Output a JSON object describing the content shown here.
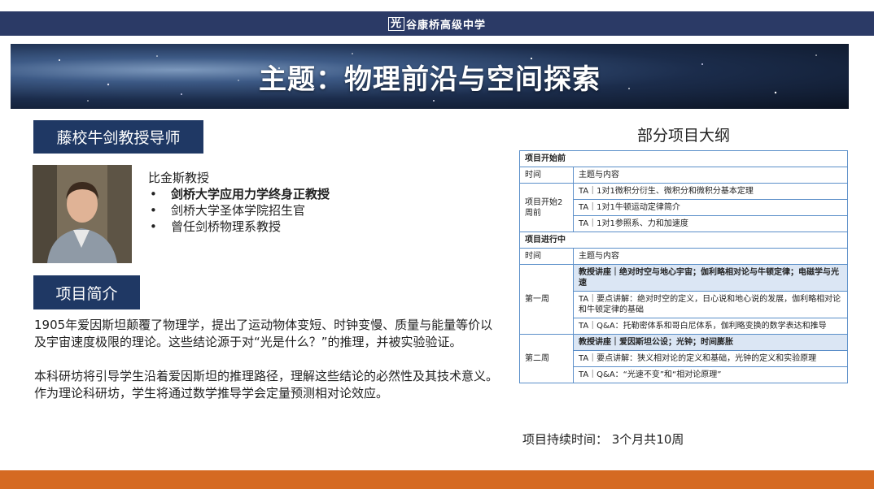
{
  "header": {
    "logo_char": "光",
    "school_name": "谷康桥高级中学"
  },
  "banner": {
    "title": "主题：物理前沿与空间探索"
  },
  "professor": {
    "section_label": "藤校牛剑教授导师",
    "name": "比金斯教授",
    "credentials": [
      {
        "text": "剑桥大学应用力学终身正教授",
        "bold": true
      },
      {
        "text": "剑桥大学圣体学院招生官",
        "bold": false
      },
      {
        "text": "曾任剑桥物理系教授",
        "bold": false
      }
    ]
  },
  "intro": {
    "section_label": "项目简介",
    "paragraphs": [
      "1905年爱因斯坦颠覆了物理学，提出了运动物体变短、时钟变慢、质量与能量等价以及宇宙速度极限的理论。这些结论源于对“光是什么？”的推理，并被实验验证。",
      "本科研坊将引导学生沿着爱因斯坦的推理路径，理解这些结论的必然性及其技术意义。作为理论科研坊，学生将通过数学推导学会定量预测相对论效应。"
    ]
  },
  "outline": {
    "title": "部分项目大纲",
    "before": {
      "header": "项目开始前",
      "col_time": "时间",
      "col_topic": "主题与内容",
      "period": "项目开始2周前",
      "rows": [
        "TA｜1对1微积分衍生、微积分和微积分基本定理",
        "TA｜1对1牛顿运动定律简介",
        "TA｜1对1参照系、力和加速度"
      ]
    },
    "during": {
      "header": "项目进行中",
      "col_time": "时间",
      "col_topic": "主题与内容",
      "week1": {
        "label": "第一周",
        "lecture": "教授讲座｜绝对时空与地心宇宙；伽利略相对论与牛顿定律；电磁学与光速",
        "rows": [
          "TA｜要点讲解：绝对时空的定义，日心说和地心说的发展，伽利略相对论和牛顿定律的基础",
          "TA｜Q&A：托勒密体系和哥白尼体系，伽利略变换的数学表达和推导"
        ]
      },
      "week2": {
        "label": "第二周",
        "lecture": "教授讲座｜爱因斯坦公设；光钟；时间膨胀",
        "rows": [
          "TA｜要点讲解：狭义相对论的定义和基础，光钟的定义和实验原理",
          "TA｜Q&A：“光速不变”和“相对论原理”"
        ]
      }
    }
  },
  "duration": "项目持续时间：  3个月共10周",
  "colors": {
    "navy": "#1f3864",
    "topbar": "#2b3a66",
    "accent": "#d56a22",
    "table_border": "#5b8fc9",
    "highlight": "#dbe6f4"
  }
}
